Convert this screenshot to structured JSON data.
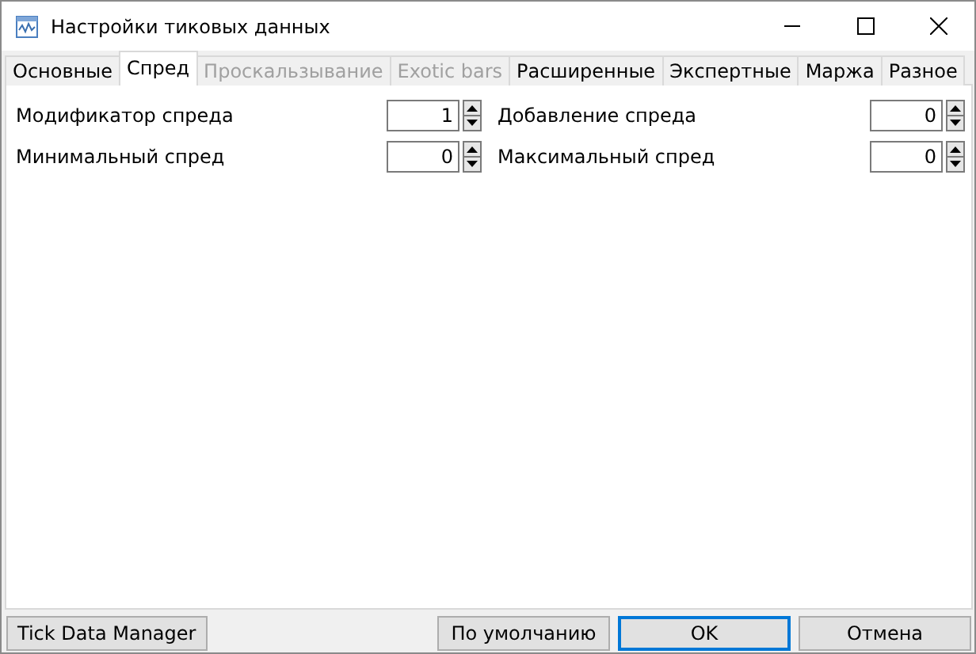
{
  "window": {
    "title": "Настройки тиковых данных"
  },
  "tabs": [
    {
      "label": "Основные",
      "selected": false,
      "disabled": false
    },
    {
      "label": "Спред",
      "selected": true,
      "disabled": false
    },
    {
      "label": "Проскальзывание",
      "selected": false,
      "disabled": true
    },
    {
      "label": "Exotic bars",
      "selected": false,
      "disabled": true
    },
    {
      "label": "Расширенные",
      "selected": false,
      "disabled": false
    },
    {
      "label": "Экспертные",
      "selected": false,
      "disabled": false
    },
    {
      "label": "Маржа",
      "selected": false,
      "disabled": false
    },
    {
      "label": "Разное",
      "selected": false,
      "disabled": false
    }
  ],
  "fields": [
    {
      "label": "Модификатор спреда",
      "value": "1"
    },
    {
      "label": "Добавление спреда",
      "value": "0"
    },
    {
      "label": "Минимальный спред",
      "value": "0"
    },
    {
      "label": "Максимальный спред",
      "value": "0"
    }
  ],
  "buttons": [
    {
      "label": "Tick Data Manager",
      "kind": "left",
      "default": false
    },
    {
      "label": "По умолчанию",
      "kind": "right",
      "default": false
    },
    {
      "label": "OK",
      "kind": "right",
      "default": true
    },
    {
      "label": "Отмена",
      "kind": "right",
      "default": false
    }
  ]
}
